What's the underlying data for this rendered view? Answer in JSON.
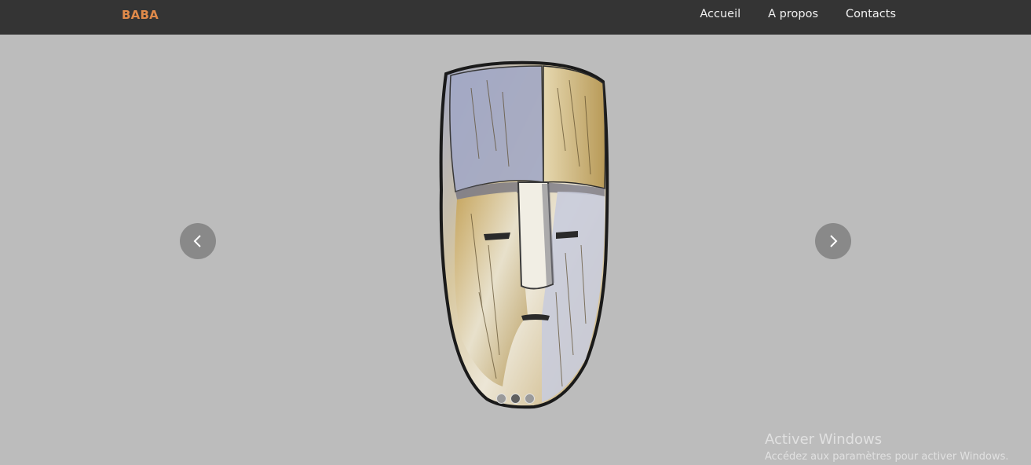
{
  "navbar": {
    "brand": "BABA",
    "brand_color": "#e08a4a",
    "links": [
      {
        "label": "Accueil"
      },
      {
        "label": "A propos"
      },
      {
        "label": "Contacts"
      }
    ]
  },
  "carousel": {
    "image_icon": "wooden-mask-image",
    "prev_icon": "chevron-left-icon",
    "next_icon": "chevron-right-icon",
    "slide_count": 3,
    "active_slide": 2
  },
  "watermark": {
    "title": "Activer Windows",
    "subtitle": "Accédez aux paramètres pour activer Windows."
  }
}
